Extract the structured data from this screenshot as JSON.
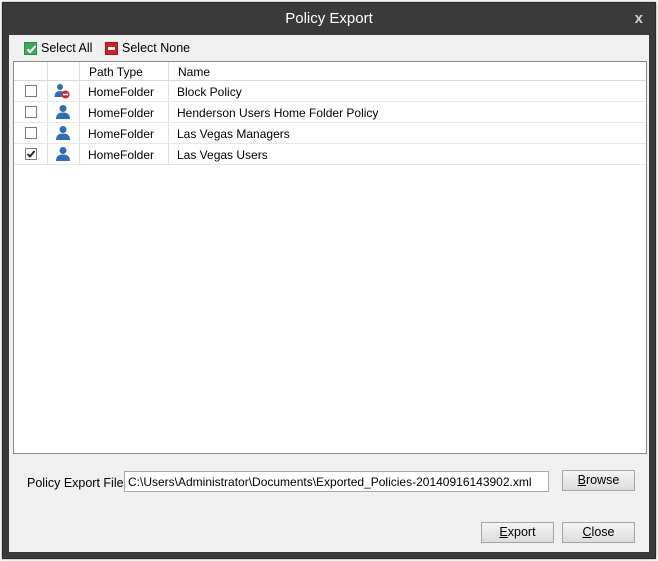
{
  "window": {
    "title": "Policy Export",
    "close_symbol": "x"
  },
  "toolbar": {
    "select_all": "Select All",
    "select_none": "Select None"
  },
  "grid": {
    "columns": [
      "Path Type",
      "Name"
    ],
    "rows": [
      {
        "checked": false,
        "icon": "user-blocked-icon",
        "path_type": "HomeFolder",
        "name": "Block Policy"
      },
      {
        "checked": false,
        "icon": "user-icon",
        "path_type": "HomeFolder",
        "name": "Henderson Users Home Folder Policy"
      },
      {
        "checked": false,
        "icon": "user-icon",
        "path_type": "HomeFolder",
        "name": "Las Vegas Managers"
      },
      {
        "checked": true,
        "icon": "user-icon",
        "path_type": "HomeFolder",
        "name": "Las Vegas Users"
      }
    ]
  },
  "export_file": {
    "label": "Policy Export File",
    "value": "C:\\Users\\Administrator\\Documents\\Exported_Policies-20140916143902.xml"
  },
  "buttons": {
    "browse_first": "B",
    "browse_rest": "rowse",
    "export_first": "E",
    "export_rest": "xport",
    "close_first": "C",
    "close_rest": "lose"
  },
  "colors": {
    "titlebar": "#3a3a3a",
    "client": "#f0f0f0",
    "user_icon": "#2f6db5",
    "block_badge": "#d0242b",
    "select_all": "#3fa95b",
    "select_none": "#c8232a"
  }
}
